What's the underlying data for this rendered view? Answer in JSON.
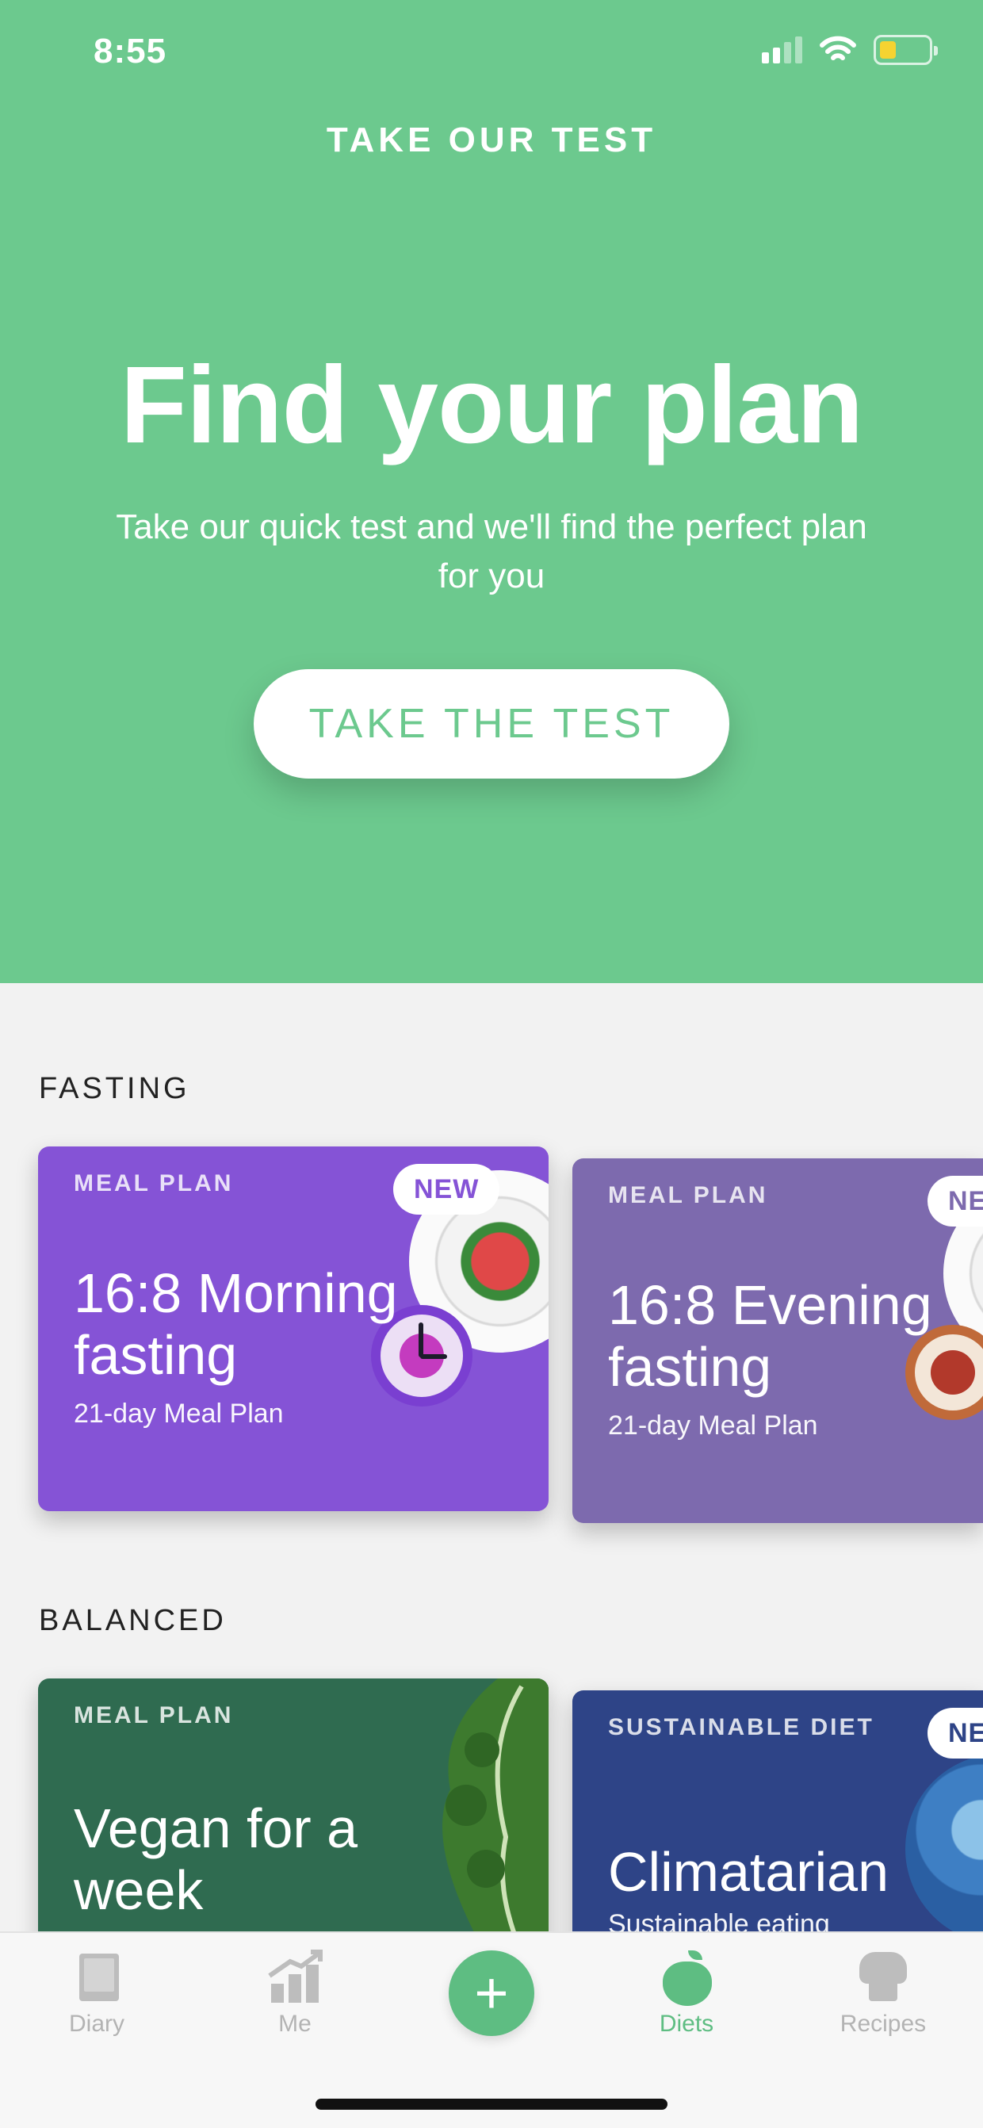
{
  "status_bar": {
    "time": "8:55"
  },
  "hero": {
    "eyebrow": "TAKE OUR TEST",
    "title": "Find your plan",
    "subtitle": "Take our quick test and we'll find the perfect plan for you",
    "cta_label": "TAKE THE TEST"
  },
  "sections": [
    {
      "title": "FASTING",
      "cards": [
        {
          "kicker": "MEAL PLAN",
          "badge": "NEW",
          "title": "16:8 Morning fasting",
          "meta": "21-day Meal Plan",
          "color": "#8553d6"
        },
        {
          "kicker": "MEAL PLAN",
          "badge": "NE",
          "title": "16:8 Evening fasting",
          "meta": "21-day Meal Plan",
          "color": "#7d6aae"
        }
      ]
    },
    {
      "title": "BALANCED",
      "cards": [
        {
          "kicker": "MEAL PLAN",
          "title": "Vegan for a week",
          "color": "#2f6b50"
        },
        {
          "kicker": "SUSTAINABLE DIET",
          "badge": "NE",
          "title": "Climatarian",
          "meta": "Sustainable eating",
          "color": "#2e4487"
        }
      ]
    }
  ],
  "tabbar": {
    "items": [
      {
        "label": "Diary",
        "icon": "diary-icon"
      },
      {
        "label": "Me",
        "icon": "progress-chart-icon"
      },
      {
        "label": "",
        "icon": "plus-icon"
      },
      {
        "label": "Diets",
        "icon": "apple-icon"
      },
      {
        "label": "Recipes",
        "icon": "chef-hat-icon"
      }
    ],
    "active": "Diets",
    "fab_symbol": "+"
  },
  "colors": {
    "brand_green": "#6cc98e",
    "active_tab": "#5ebd82"
  }
}
